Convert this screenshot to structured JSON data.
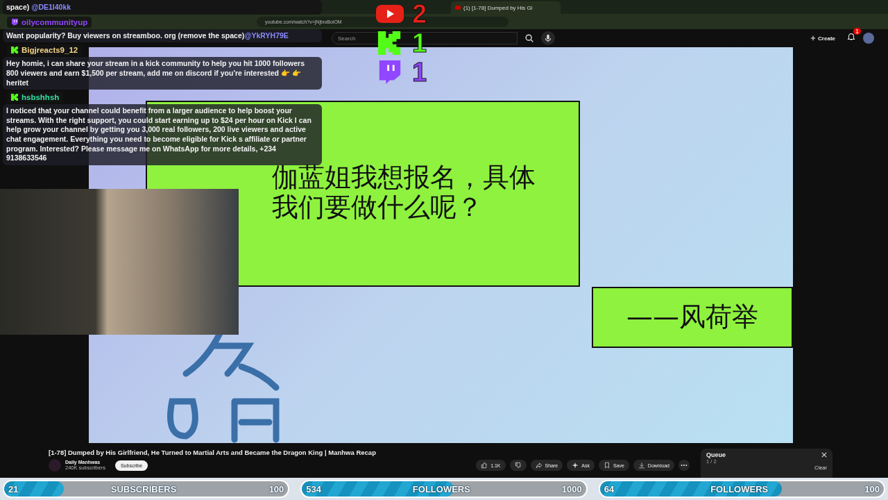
{
  "browser": {
    "tab_title": "(1) [1-78] Dumped by His Gi",
    "url": "youtube.com/watch?v=jNjtxoBoiOM"
  },
  "youtube": {
    "search": {
      "placeholder": "Search"
    },
    "create": "Create",
    "notification_count": "1"
  },
  "video": {
    "line_1": "伽蓝姐我想报名，具体",
    "line_2": "我们要做什么呢？",
    "signature": "——风荷举"
  },
  "counters": [
    {
      "kind": "youtube",
      "count": "2"
    },
    {
      "kind": "kick",
      "count": "1"
    },
    {
      "kind": "twitch",
      "count": "1"
    }
  ],
  "chat": {
    "cut_message": {
      "text": "space)",
      "mention": "@DE1I40kk"
    },
    "messages": [
      {
        "kind": "twitch",
        "user": "oilycommunityup",
        "color": "#9146ff",
        "text": "Want popularity? Buy viewers on streamboo. org (remove the space)",
        "mention": "@YkRYH79E"
      },
      {
        "kind": "kick",
        "user": "Bigjreacts9_12",
        "color": "#f5d58a",
        "text": "Hey homie, i can share your stream in a kick community to help you hit 1000 followers 800 viewers and earn $1,500 per stream, add me on discord if you're interested 👉 👉 heritet"
      },
      {
        "kind": "kick",
        "user": "hsbshhsh",
        "color": "#34e0a1",
        "text": "I noticed that your channel could benefit from a larger audience to help boost your streams. With the right support, you could start earning up to $24 per hour on Kick I can help grow your channel by getting you 3,000 real followers, 200 live viewers and active chat engagement. Everything you need to become eligible for Kick s affiliate or partner program. Interested? Please message me on WhatsApp for more details, +234 9138633546"
      }
    ]
  },
  "info": {
    "title": "[1-78] Dumped by His Girlfriend, He Turned to Martial Arts and Became the Dragon King | Manhwa Recap",
    "channel": "Daily Manhwas",
    "subscribers": "240K subscribers",
    "subscribe": "Subscribe",
    "likes": "1.1K",
    "actions": [
      {
        "kind": "share",
        "label": "Share"
      },
      {
        "kind": "ask",
        "label": "Ask"
      },
      {
        "kind": "save",
        "label": "Save"
      },
      {
        "kind": "download",
        "label": "Download"
      }
    ],
    "queue": {
      "title": "Queue",
      "position": "1 / 2",
      "clear": "Clear"
    }
  },
  "goals": [
    {
      "current": "21",
      "label": "SUBSCRIBERS",
      "target": "100",
      "level": 0.21
    },
    {
      "current": "534",
      "label": "FOLLOWERS",
      "target": "1000",
      "level": 0.534
    },
    {
      "current": "64",
      "label": "FOLLOWERS",
      "target": "100",
      "level": 0.64
    }
  ]
}
